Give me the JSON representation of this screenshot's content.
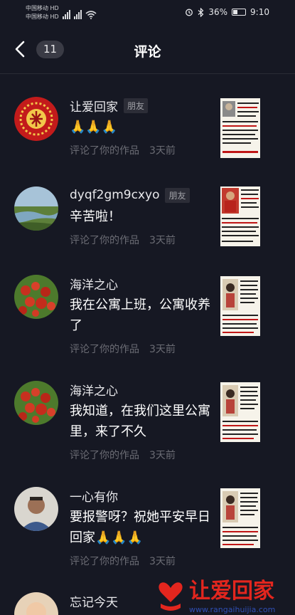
{
  "status_bar": {
    "carrier_1": "中国移动 HD",
    "carrier_2": "中国移动 HD",
    "network_1": "4G",
    "network_2": "4G",
    "battery": "36%",
    "battery_level": 0.36,
    "time": "9:10"
  },
  "header": {
    "title": "评论",
    "count": "11"
  },
  "items": [
    {
      "name": "让爱回家",
      "tag": "朋友",
      "comment": "🙏🙏🙏",
      "action": "评论了你的作品",
      "time": "3天前"
    },
    {
      "name": "dyqf2gm9cxyo",
      "tag": "朋友",
      "comment": "辛苦啦！",
      "action": "评论了你的作品",
      "time": "3天前"
    },
    {
      "name": "海洋之心",
      "tag": "",
      "comment": "我在公寓上班，公寓收养了",
      "action": "评论了你的作品",
      "time": "3天前"
    },
    {
      "name": "海洋之心",
      "tag": "",
      "comment": "我知道，在我们这里公寓里，来了不久",
      "action": "评论了你的作品",
      "time": "3天前"
    },
    {
      "name": "一心有你",
      "tag": "",
      "comment": "要报警呀？祝她平安早日回家🙏🙏🙏",
      "action": "评论了你的作品",
      "time": "3天前"
    },
    {
      "name": "忘记今天",
      "tag": "",
      "comment": "",
      "action": "",
      "time": ""
    }
  ],
  "watermark": {
    "text": "让爱回家",
    "url": "www.rangaihuijia.com"
  },
  "colors": {
    "background": "#161823",
    "text_primary": "#ffffff",
    "text_secondary": "#6b6c74",
    "badge_bg": "#3a3b45"
  }
}
